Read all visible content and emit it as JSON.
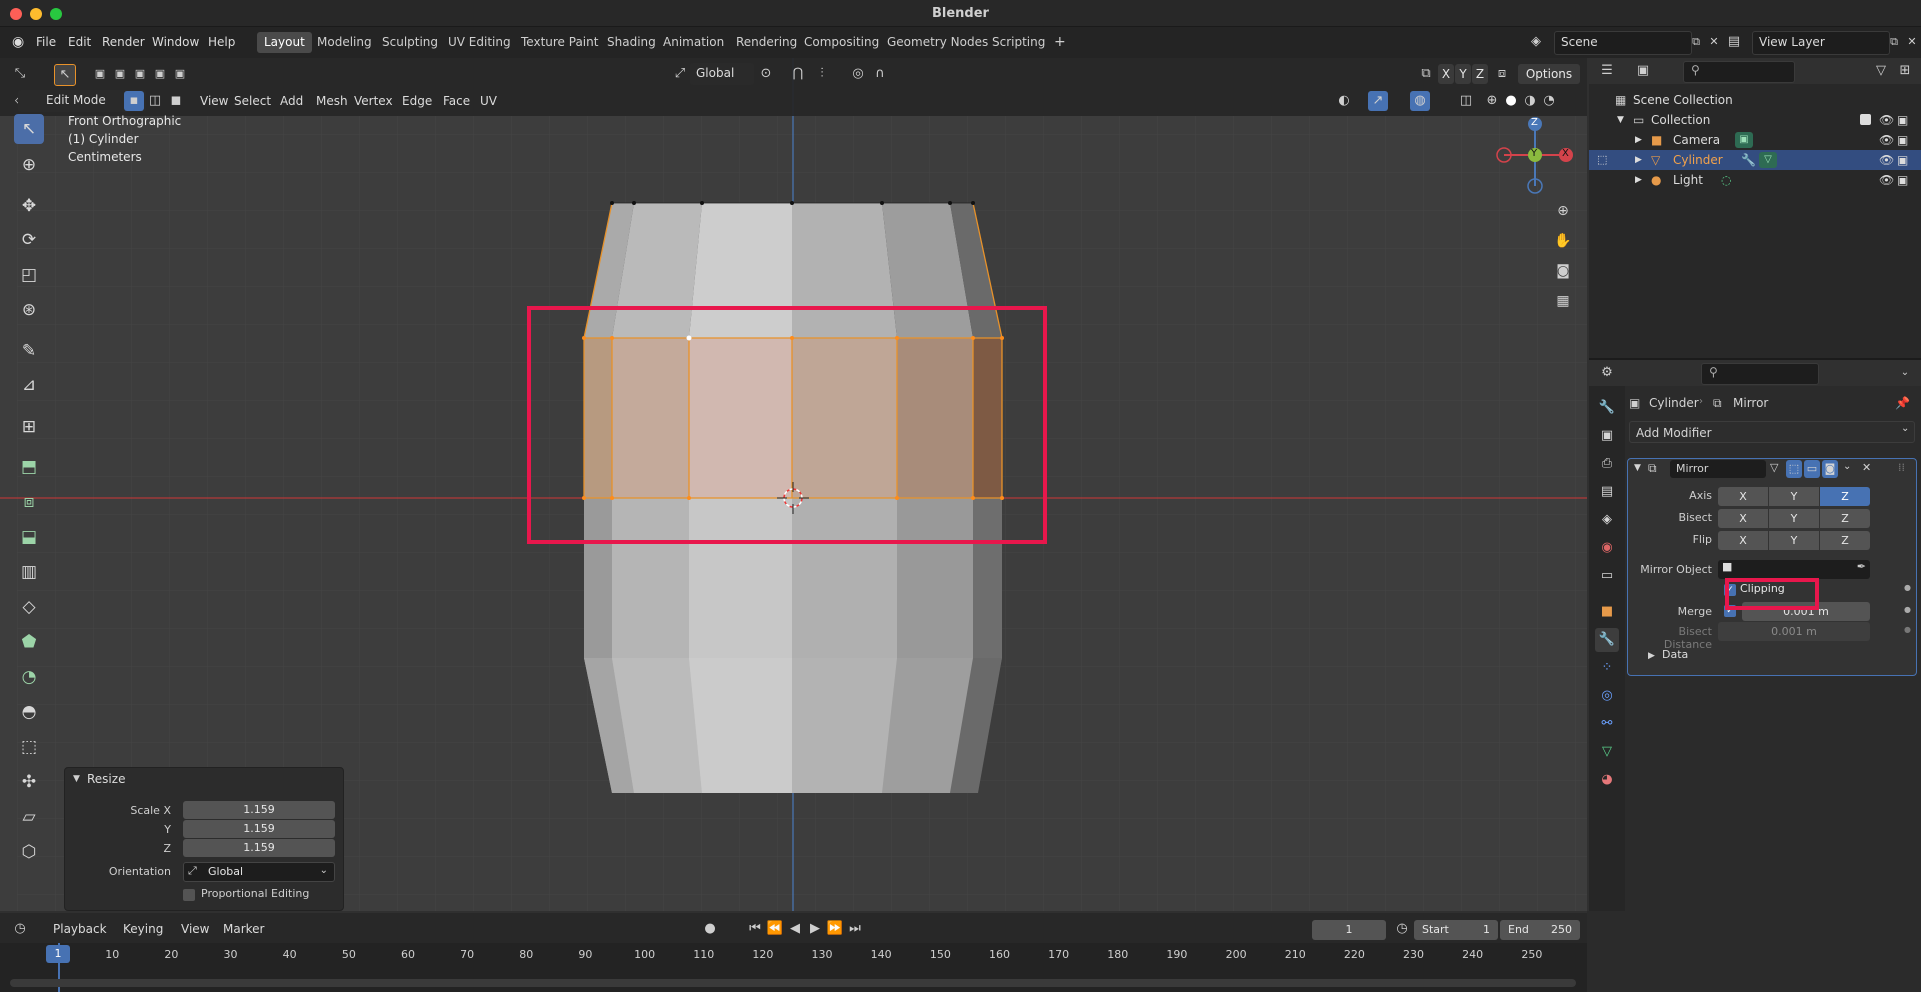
{
  "app": {
    "title": "Blender"
  },
  "menu": [
    "File",
    "Edit",
    "Render",
    "Window",
    "Help"
  ],
  "workspaces": [
    "Layout",
    "Modeling",
    "Sculpting",
    "UV Editing",
    "Texture Paint",
    "Shading",
    "Animation",
    "Rendering",
    "Compositing",
    "Geometry Nodes",
    "Scripting"
  ],
  "scene": {
    "scene_name": "Scene",
    "view_layer": "View Layer"
  },
  "viewport_header": {
    "transform_orientation": "Global",
    "options_label": "Options",
    "axis_x": "X",
    "axis_y": "Y",
    "axis_z": "Z",
    "mode": "Edit Mode",
    "menus": [
      "View",
      "Select",
      "Add",
      "Mesh",
      "Vertex",
      "Edge",
      "Face",
      "UV"
    ]
  },
  "viewport_info": {
    "view_name": "Front Orthographic",
    "object": "(1) Cylinder",
    "units": "Centimeters"
  },
  "gizmo": {
    "z": "Z",
    "y": "Y",
    "x": "X"
  },
  "resize_panel": {
    "title": "Resize",
    "scale_x_label": "Scale X",
    "scale_x": "1.159",
    "y_label": "Y",
    "scale_y": "1.159",
    "z_label": "Z",
    "scale_z": "1.159",
    "orientation_label": "Orientation",
    "orientation": "Global",
    "proportional_label": "Proportional Editing"
  },
  "outliner": {
    "root": "Scene Collection",
    "collection": "Collection",
    "items": [
      "Camera",
      "Cylinder",
      "Light"
    ]
  },
  "properties": {
    "breadcrumb_object": "Cylinder",
    "breadcrumb_modifier": "Mirror",
    "add_modifier": "Add Modifier",
    "modifier_name": "Mirror",
    "axis_label": "Axis",
    "bisect_label": "Bisect",
    "flip_label": "Flip",
    "x": "X",
    "y": "Y",
    "z": "Z",
    "mirror_object_label": "Mirror Object",
    "clipping_label": "Clipping",
    "merge_label": "Merge",
    "merge_value": "0.001 m",
    "bisect_distance_label": "Bisect Distance",
    "bisect_distance_value": "0.001 m",
    "data_label": "Data"
  },
  "timeline": {
    "menus": [
      "Playback",
      "Keying",
      "View",
      "Marker"
    ],
    "current_frame": "1",
    "start_label": "Start",
    "start": "1",
    "end_label": "End",
    "end": "250",
    "ticks": [
      "1",
      "10",
      "20",
      "30",
      "40",
      "50",
      "60",
      "70",
      "80",
      "90",
      "100",
      "110",
      "120",
      "130",
      "140",
      "150",
      "160",
      "170",
      "180",
      "190",
      "200",
      "210",
      "220",
      "230",
      "240",
      "250"
    ]
  },
  "colors": {
    "accent": "#4772b3",
    "highlight": "#e8174c",
    "selection": "#e8922a"
  }
}
